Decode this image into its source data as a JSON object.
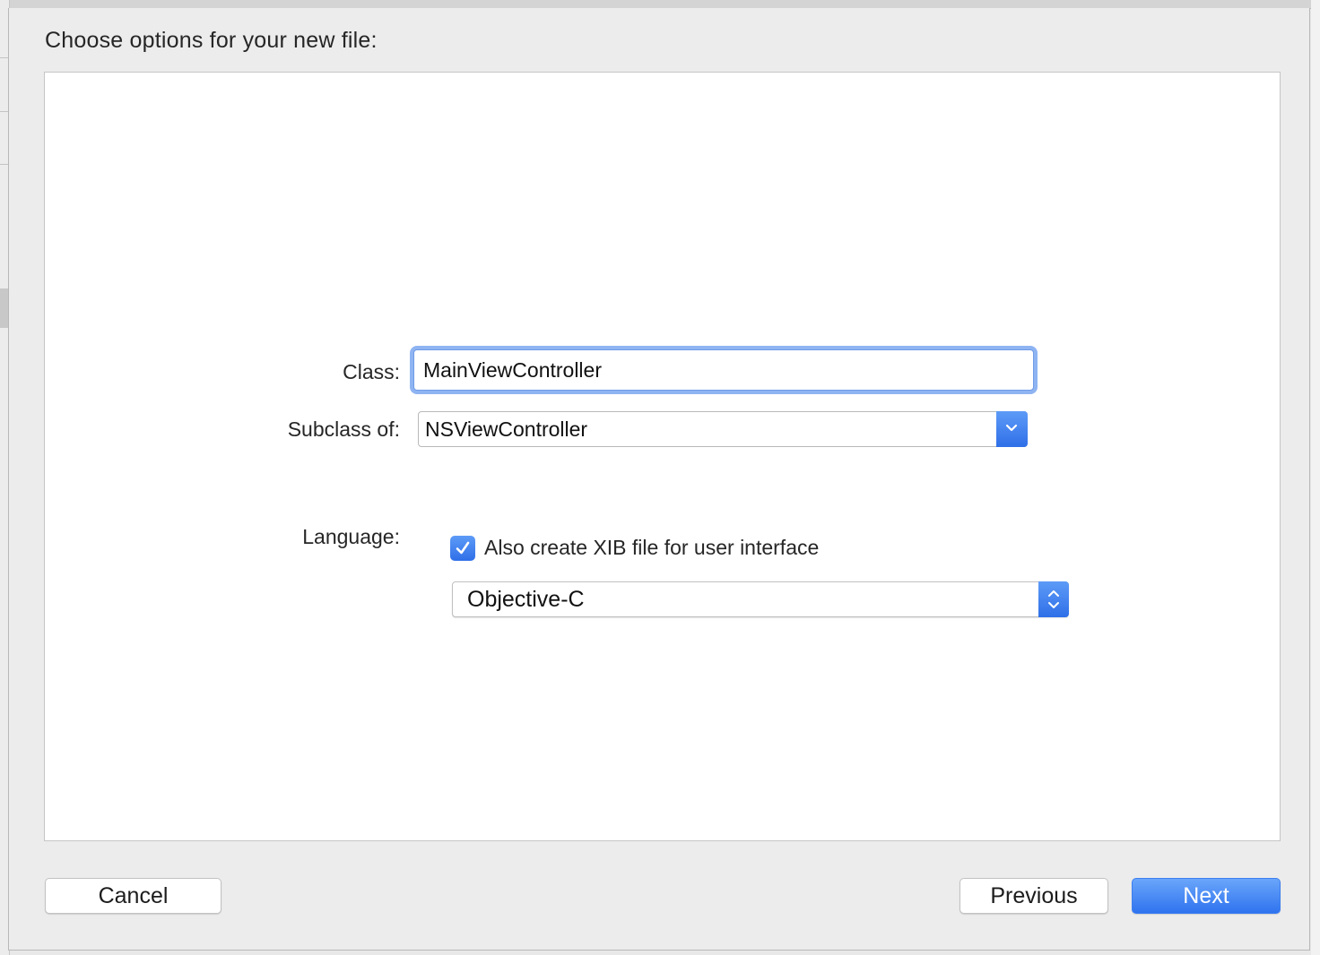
{
  "dialog": {
    "title": "Choose options for your new file:"
  },
  "form": {
    "class_label": "Class:",
    "class_value": "MainViewController",
    "subclass_label": "Subclass of:",
    "subclass_value": "NSViewController",
    "xib_checkbox_label": "Also create XIB file for user interface",
    "xib_checkbox_checked": true,
    "language_label": "Language:",
    "language_value": "Objective-C"
  },
  "buttons": {
    "cancel": "Cancel",
    "previous": "Previous",
    "next": "Next"
  },
  "icons": {
    "combo_arrow": "chevron-down-icon",
    "popup_arrows": "up-down-chevron-icon",
    "checkbox_mark": "checkmark-icon"
  },
  "colors": {
    "accent": "#3b7ef0",
    "focus_ring": "#8fb4f2"
  }
}
